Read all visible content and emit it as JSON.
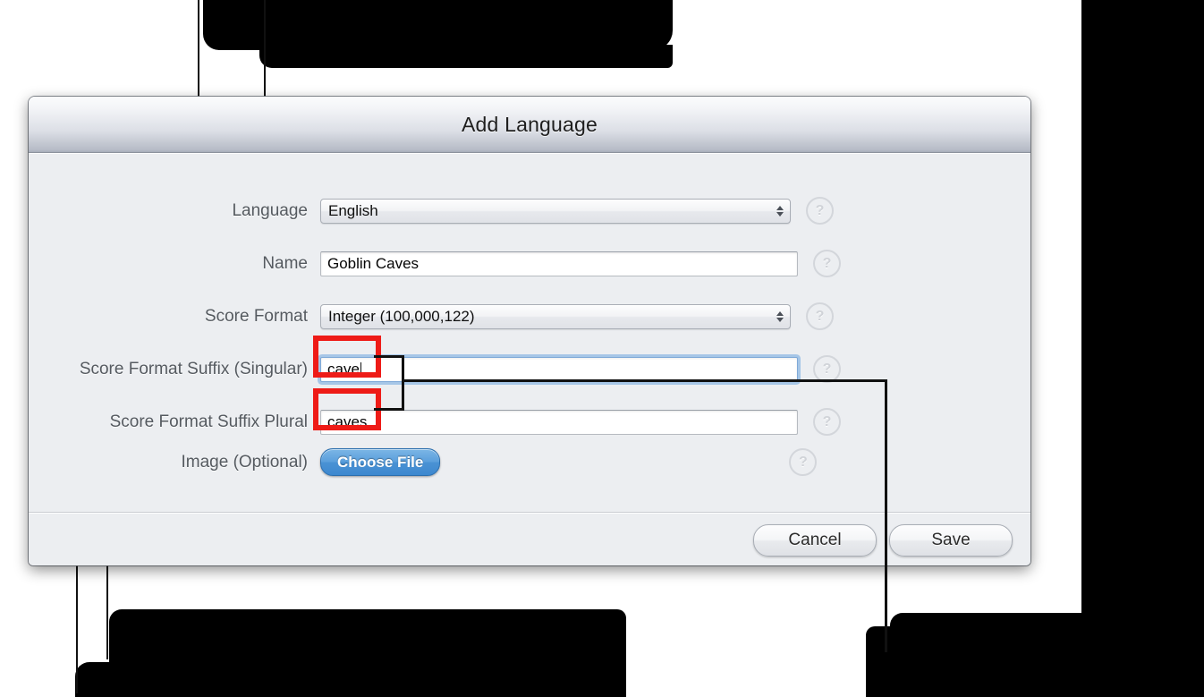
{
  "dialog": {
    "title": "Add Language",
    "rows": [
      {
        "label": "Language",
        "type": "select",
        "value": "English",
        "help": "?"
      },
      {
        "label": "Name",
        "type": "text",
        "value": "Goblin Caves",
        "help": "?"
      },
      {
        "label": "Score Format",
        "type": "select",
        "value": "Integer (100,000,122)",
        "help": "?"
      },
      {
        "label": "Score Format Suffix (Singular)",
        "type": "text",
        "value": "cave",
        "help": "?"
      },
      {
        "label": "Score Format Suffix Plural",
        "type": "text",
        "value": "caves",
        "help": "?"
      },
      {
        "label": "Image (Optional)",
        "type": "button",
        "value": "Choose File",
        "help": "?"
      }
    ],
    "footer": {
      "cancel_label": "Cancel",
      "save_label": "Save"
    }
  },
  "annotation": {
    "highlight_color": "#ee1b17",
    "line_color": "#111111",
    "redaction_color": "#000000"
  }
}
